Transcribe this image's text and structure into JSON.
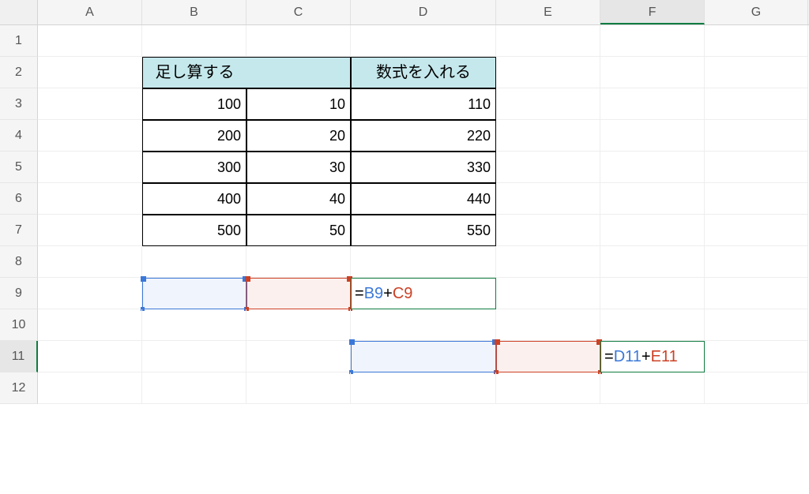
{
  "columns": [
    "A",
    "B",
    "C",
    "D",
    "E",
    "F",
    "G"
  ],
  "rows": [
    "1",
    "2",
    "3",
    "4",
    "5",
    "6",
    "7",
    "8",
    "9",
    "10",
    "11",
    "12"
  ],
  "selected_col": "F",
  "selected_row": "11",
  "table": {
    "header_left": "足し算する",
    "header_right": "数式を入れる",
    "rows": [
      {
        "b": "100",
        "c": "10",
        "d": "110"
      },
      {
        "b": "200",
        "c": "20",
        "d": "220"
      },
      {
        "b": "300",
        "c": "30",
        "d": "330"
      },
      {
        "b": "400",
        "c": "40",
        "d": "440"
      },
      {
        "b": "500",
        "c": "50",
        "d": "550"
      }
    ]
  },
  "formula1": {
    "eq": "=",
    "ref1": "B9",
    "plus": "+",
    "ref2": "C9"
  },
  "formula2": {
    "eq": "=",
    "ref1": "D11",
    "plus": "+",
    "ref2": "E11"
  }
}
